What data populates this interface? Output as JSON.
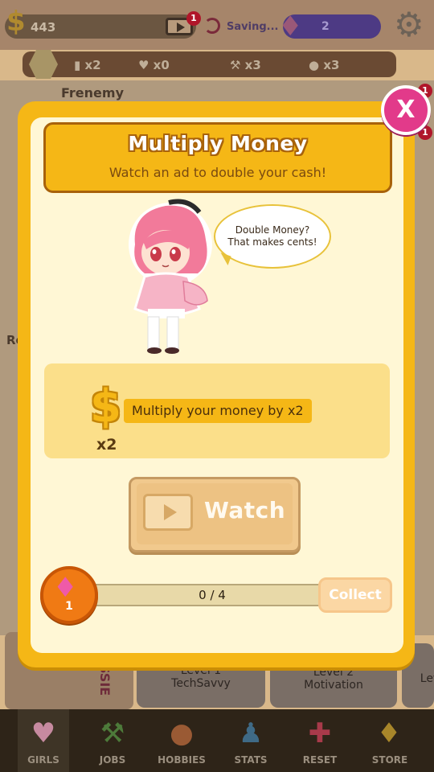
{
  "hud": {
    "money": "443",
    "video_badge": "1",
    "saving_label": "Saving...",
    "gems": "2"
  },
  "stats": [
    {
      "icon": "token-icon",
      "count": "x2"
    },
    {
      "icon": "hearts-icon",
      "count": "x0"
    },
    {
      "icon": "shovel-icon",
      "count": "x3"
    },
    {
      "icon": "ball-icon",
      "count": "x3"
    }
  ],
  "background": {
    "frenemy_label": "Frenemy",
    "re_label": "Re",
    "girl_name_partial": "SSIE",
    "cards": [
      {
        "level": "Level 1",
        "name": "TechSavvy"
      },
      {
        "level": "Level 2",
        "name": "Motivation"
      },
      {
        "level": "Lev",
        "name": ""
      }
    ],
    "notif_1": "1",
    "notif_2": "1"
  },
  "modal": {
    "title": "Multiply Money",
    "subtitle": "Watch an ad to double your cash!",
    "close_label": "X",
    "speech": [
      "Double Money?",
      "That makes cents!"
    ],
    "multiplier_icon_label": "x2",
    "multiplier_text": "Multiply your money by x2",
    "watch_label": "Watch",
    "reward_gems": "1",
    "progress_text": "0 / 4",
    "progress_fraction": 0,
    "collect_label": "Collect"
  },
  "tabs": [
    {
      "label": "GIRLS",
      "icon": "hearts-icon",
      "active": true
    },
    {
      "label": "JOBS",
      "icon": "shovel-icon",
      "active": false
    },
    {
      "label": "HOBBIES",
      "icon": "ball-icon",
      "active": false
    },
    {
      "label": "STATS",
      "icon": "person-icon",
      "active": false
    },
    {
      "label": "RESET",
      "icon": "reset-cross-icon",
      "active": false
    },
    {
      "label": "STORE",
      "icon": "gem-store-icon",
      "active": false
    }
  ],
  "colors": {
    "modal_gold": "#f5b716",
    "close_pink": "#e23a8a",
    "gem_orange": "#f07a14"
  }
}
